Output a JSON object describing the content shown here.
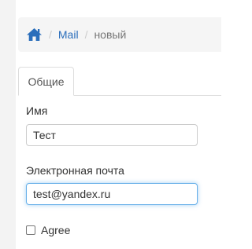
{
  "breadcrumb": {
    "home_icon": "home-icon",
    "separator": "/",
    "items": [
      {
        "label": "Mail"
      },
      {
        "label": "новый"
      }
    ],
    "link_color": "#2a6ebb",
    "active_color": "#777777"
  },
  "tabs": [
    {
      "label": "Общие",
      "active": true
    }
  ],
  "form": {
    "name": {
      "label": "Имя",
      "value": "Тест"
    },
    "email": {
      "label": "Электронная почта",
      "value": "test@yandex.ru",
      "focused": true
    },
    "agree": {
      "label": "Agree",
      "checked": false
    }
  },
  "colors": {
    "focus_border": "#66afe9",
    "home_icon": "#2a6ebb"
  }
}
